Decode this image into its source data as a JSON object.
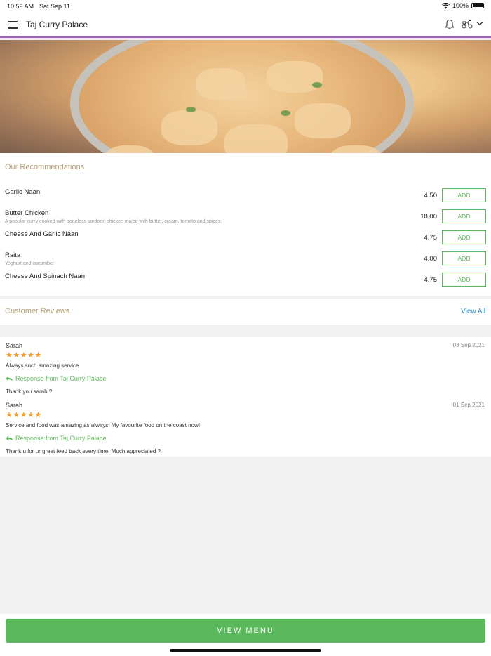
{
  "status": {
    "time": "10:59 AM",
    "date": "Sat Sep 11",
    "battery": "100%"
  },
  "header": {
    "title": "Taj Curry Palace"
  },
  "icons": {
    "menu": "hamburger-icon",
    "notifications": "bell-icon",
    "delivery": "scooter-icon",
    "dropdown": "chevron-down-icon",
    "reply": "reply-arrow-icon",
    "star": "star-icon"
  },
  "colors": {
    "accent_purple": "#9b5fb5",
    "green": "#5cb85c",
    "section_title": "#b8a27a",
    "link_blue": "#2f8fc4",
    "star_orange": "#f39a2b"
  },
  "recommendations": {
    "title": "Our Recommendations",
    "items": [
      {
        "name": "Garlic Naan",
        "description": "",
        "price": "4.50",
        "button": "ADD"
      },
      {
        "name": "Butter Chicken",
        "description": "A popular curry cooked with boneless tandoori chicken mixed with butter, cream, tomato and spices.",
        "price": "18.00",
        "button": "ADD"
      },
      {
        "name": "Cheese And Garlic Naan",
        "description": "",
        "price": "4.75",
        "button": "ADD"
      },
      {
        "name": "Raita",
        "description": "Yoghurt and cucumber",
        "price": "4.00",
        "button": "ADD"
      },
      {
        "name": "Cheese And Spinach Naan",
        "description": "",
        "price": "4.75",
        "button": "ADD"
      }
    ]
  },
  "reviews": {
    "title": "Customer Reviews",
    "view_all": "View All",
    "items": [
      {
        "name": "Sarah",
        "date": "03 Sep 2021",
        "rating": 5,
        "stars": "★★★★★",
        "text": "Always such amazing service",
        "response_label": "Response from Taj Curry Palace",
        "response": "Thank you sarah ?"
      },
      {
        "name": "Sarah",
        "date": "01 Sep 2021",
        "rating": 5,
        "stars": "★★★★★",
        "text": "Service and food was amazing as always. My favourite food on the coast now!",
        "response_label": "Response from Taj Curry Palace",
        "response": "Thank u for ur great feed back every time. Much appreciated ?"
      }
    ]
  },
  "footer": {
    "view_menu": "VIEW MENU"
  }
}
